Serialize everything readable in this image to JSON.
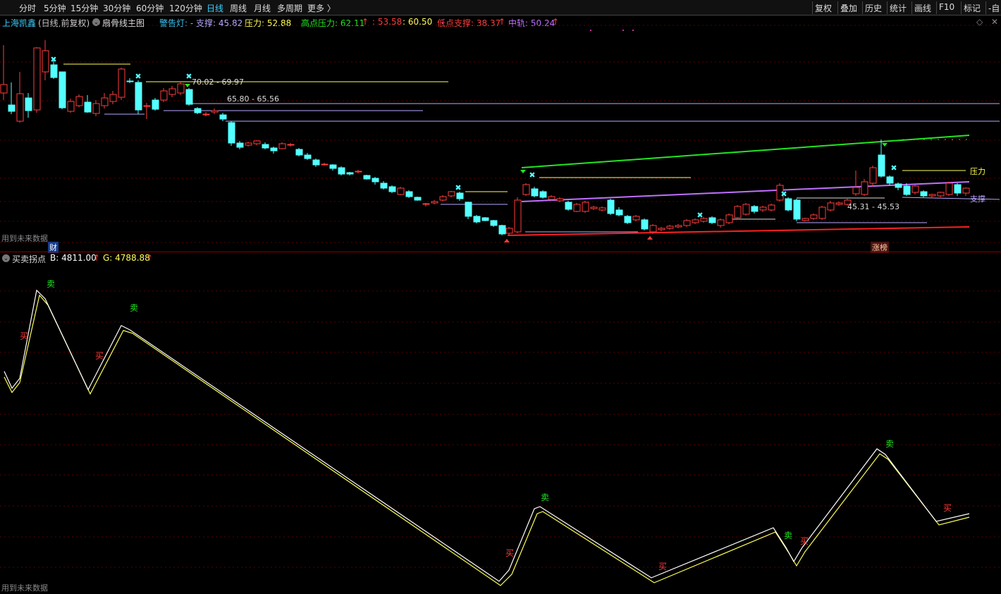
{
  "toolbar": {
    "timeframes": [
      "分时",
      "5分钟",
      "15分钟",
      "30分钟",
      "60分钟",
      "120分钟",
      "日线",
      "周线",
      "月线",
      "多周期",
      "更多 〉"
    ],
    "active": "日线",
    "right_buttons": [
      "复权",
      "叠加",
      "历史",
      "统计",
      "画线",
      "F10",
      "标记",
      "-自"
    ]
  },
  "main_panel": {
    "stock_name": "上海凯鑫",
    "period_label": "(日线,前复权)",
    "indicator_name": "扇骨线主图",
    "warn_label": "警告灯: -",
    "support_label": "支撑: 45.82",
    "pressure_label": "压力: 52.88",
    "high_pressure_label": "高点压力: 62.11",
    "val2": ": 53.58",
    "val3": ": 60.50",
    "low_support_label": "低点支撑: 38.37",
    "mid_label": "中轨: 50.24",
    "range1": "70.02 - 69.97",
    "range2": "65.80 - 65.56",
    "range3": "45.31 - 45.53",
    "pressure_tag": "压力",
    "support_tag": "支撑",
    "fin_badge": "财",
    "zt_badge": "涨榜",
    "future_note": "用到未来数据"
  },
  "sub_panel": {
    "indicator_name": "买卖拐点",
    "b_label": "B: 4811.00",
    "g_label": "G: 4788.88",
    "buy_label": "买",
    "sell_label": "卖",
    "future_note": "用到未来数据"
  },
  "colors": {
    "up": "#ff3c3c",
    "down": "#54ffff",
    "grid": "#5a0000",
    "green_line": "#22e622",
    "purple_line": "#c070ff",
    "red_line": "#ff2020",
    "yellow": "#ffff55",
    "lavender": "#b8a8ff"
  }
}
